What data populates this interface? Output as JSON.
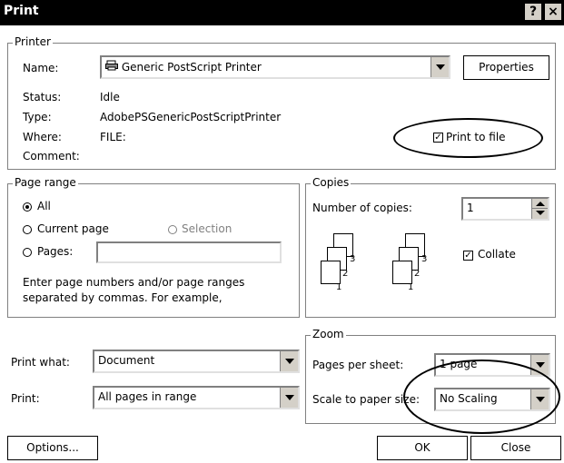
{
  "window": {
    "title": "Print",
    "help_button": "?",
    "close_button": "×"
  },
  "printer": {
    "group_label": "Printer",
    "name_label": "Name:",
    "name_value": "Generic PostScript Printer",
    "properties_button": "Properties",
    "status_label": "Status:",
    "status_value": "Idle",
    "type_label": "Type:",
    "type_value": "AdobePSGenericPostScriptPrinter",
    "where_label": "Where:",
    "where_value": "FILE:",
    "comment_label": "Comment:",
    "print_to_file_label": "Print to file",
    "print_to_file_checked": true
  },
  "page_range": {
    "group_label": "Page range",
    "all_label": "All",
    "current_page_label": "Current page",
    "selection_label": "Selection",
    "pages_label": "Pages:",
    "pages_value": "",
    "help_text_line1": "Enter page numbers and/or page ranges",
    "help_text_line2": "separated by commas.  For example,"
  },
  "copies": {
    "group_label": "Copies",
    "number_label": "Number of copies:",
    "number_value": "1",
    "collate_label": "Collate",
    "collate_checked": true,
    "stack_labels": [
      "3",
      "2",
      "1"
    ]
  },
  "print_what": {
    "label": "Print what:",
    "value": "Document"
  },
  "print": {
    "label": "Print:",
    "value": "All pages in range"
  },
  "zoom": {
    "group_label": "Zoom",
    "pages_per_sheet_label": "Pages per sheet:",
    "pages_per_sheet_value": "1 page",
    "scale_label": "Scale to paper size:",
    "scale_value": "No Scaling"
  },
  "buttons": {
    "options": "Options...",
    "ok": "OK",
    "close": "Close"
  }
}
